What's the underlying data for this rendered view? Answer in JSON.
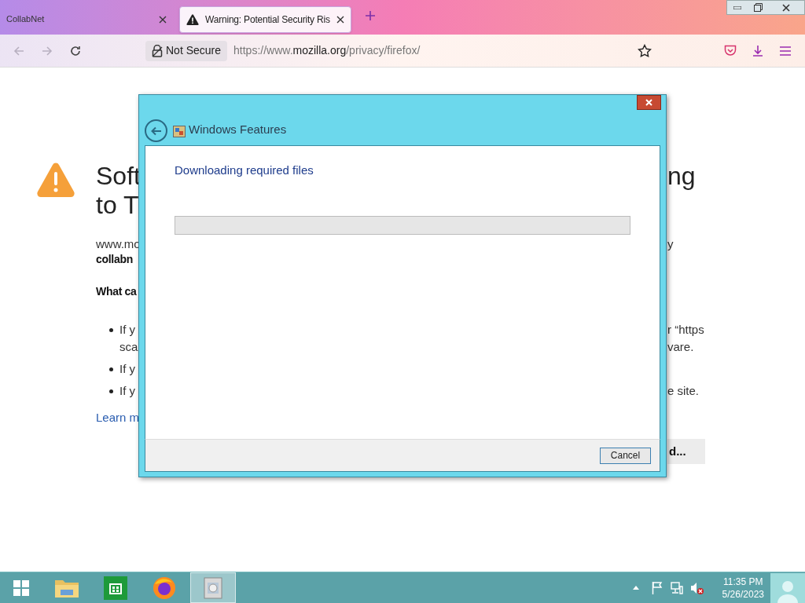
{
  "browser": {
    "tabs": [
      {
        "label": "CollabNet",
        "selected": false
      },
      {
        "label": "Warning: Potential Security Ris",
        "selected": true
      }
    ],
    "security_label": "Not Secure",
    "url": {
      "prefix": "https://www.",
      "domain": "mozilla.org",
      "path": "/privacy/firefox/"
    }
  },
  "page": {
    "rows": [
      {
        "kind": "heading",
        "left": "Soft",
        "right": "ng"
      },
      {
        "kind": "heading",
        "left": "to T"
      },
      {
        "kind": "gap"
      },
      {
        "kind": "text",
        "left": "www.mo",
        "right": "y"
      },
      {
        "kind": "bold",
        "left": "collabn"
      },
      {
        "kind": "gap"
      },
      {
        "kind": "bold",
        "left": "What ca"
      },
      {
        "kind": "gap"
      },
      {
        "kind": "bullet",
        "left": "If y",
        "right": "r “https"
      },
      {
        "kind": "cont",
        "left": "sca",
        "right": "vare."
      },
      {
        "kind": "bullet",
        "left": "If y"
      },
      {
        "kind": "bullet",
        "left": "If y",
        "right": "e site."
      },
      {
        "kind": "link",
        "left": "Learn m"
      },
      {
        "kind": "button",
        "right": "d..."
      }
    ]
  },
  "dialog": {
    "title": "Windows Features",
    "message": "Downloading required files",
    "buttons": [
      "Cancel"
    ]
  },
  "taskbar": {
    "apps": [
      {
        "kind": "explorer",
        "selected": false
      },
      {
        "kind": "store",
        "selected": false
      },
      {
        "kind": "firefox",
        "selected": false
      },
      {
        "kind": "features",
        "selected": true
      }
    ],
    "time": "11:35 PM",
    "date": "5/26/2023"
  }
}
